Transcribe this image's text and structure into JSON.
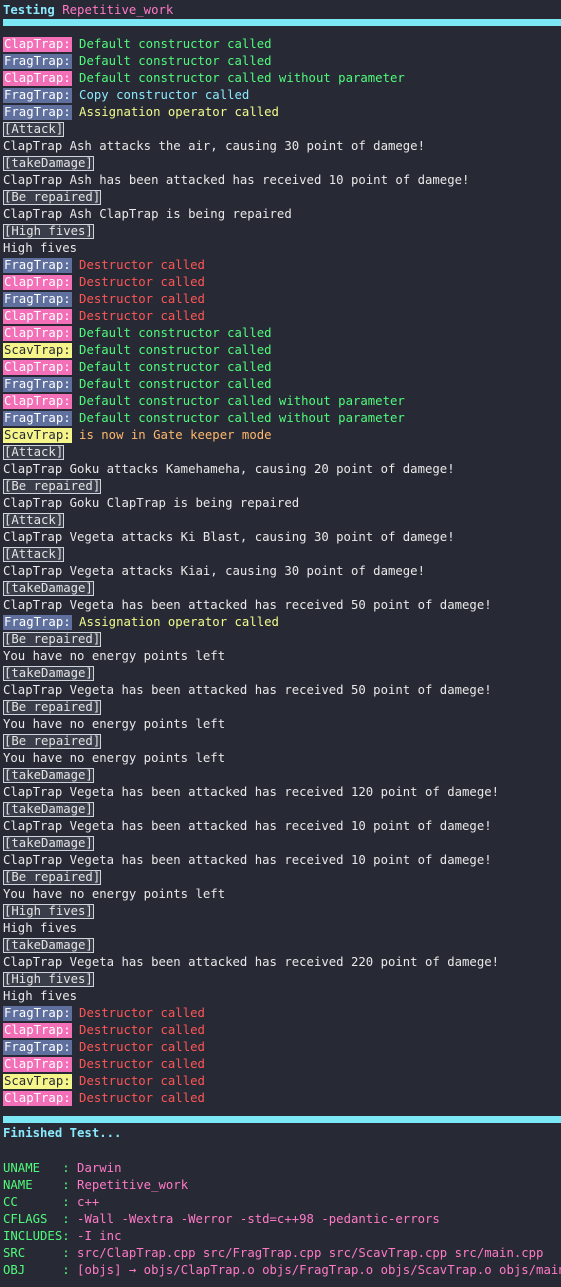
{
  "header": {
    "label": "Testing",
    "name": "Repetitive_work"
  },
  "lines": [
    {
      "kind": "tagged",
      "tag": "ClapTrap:",
      "cls": "clap",
      "text": "Default constructor called",
      "color": "green"
    },
    {
      "kind": "tagged",
      "tag": "FragTrap:",
      "cls": "frag",
      "text": "Default constructor called",
      "color": "green"
    },
    {
      "kind": "tagged",
      "tag": "ClapTrap:",
      "cls": "clap",
      "text": "Default constructor called without parameter",
      "color": "green"
    },
    {
      "kind": "tagged",
      "tag": "FragTrap:",
      "cls": "frag",
      "text": "Copy constructor called",
      "color": "cyan"
    },
    {
      "kind": "tagged",
      "tag": "FragTrap:",
      "cls": "frag",
      "text": "Assignation operator called",
      "color": "yellow"
    },
    {
      "kind": "action",
      "text": "[Attack]"
    },
    {
      "kind": "plain",
      "text": "ClapTrap Ash attacks the air, causing 30 point of damege!"
    },
    {
      "kind": "action",
      "text": "[takeDamage]"
    },
    {
      "kind": "plain",
      "text": "ClapTrap Ash has been attacked has received 10 point of damege!"
    },
    {
      "kind": "action",
      "text": "[Be repaired]"
    },
    {
      "kind": "plain",
      "text": "ClapTrap Ash ClapTrap is being repaired"
    },
    {
      "kind": "action",
      "text": "[High fives]"
    },
    {
      "kind": "plain",
      "text": "High fives"
    },
    {
      "kind": "tagged",
      "tag": "FragTrap:",
      "cls": "frag",
      "text": "Destructor called",
      "color": "red"
    },
    {
      "kind": "tagged",
      "tag": "ClapTrap:",
      "cls": "clap",
      "text": "Destructor called",
      "color": "red"
    },
    {
      "kind": "tagged",
      "tag": "FragTrap:",
      "cls": "frag",
      "text": "Destructor called",
      "color": "red"
    },
    {
      "kind": "tagged",
      "tag": "ClapTrap:",
      "cls": "clap",
      "text": "Destructor called",
      "color": "red"
    },
    {
      "kind": "tagged",
      "tag": "ClapTrap:",
      "cls": "clap",
      "text": "Default constructor called",
      "color": "green"
    },
    {
      "kind": "tagged",
      "tag": "ScavTrap:",
      "cls": "scav",
      "text": "Default constructor called",
      "color": "green"
    },
    {
      "kind": "tagged",
      "tag": "ClapTrap:",
      "cls": "clap",
      "text": "Default constructor called",
      "color": "green"
    },
    {
      "kind": "tagged",
      "tag": "FragTrap:",
      "cls": "frag",
      "text": "Default constructor called",
      "color": "green"
    },
    {
      "kind": "tagged",
      "tag": "ClapTrap:",
      "cls": "clap",
      "text": "Default constructor called without parameter",
      "color": "green"
    },
    {
      "kind": "tagged",
      "tag": "FragTrap:",
      "cls": "frag",
      "text": "Default constructor called without parameter",
      "color": "green"
    },
    {
      "kind": "tagged",
      "tag": "ScavTrap:",
      "cls": "scav",
      "text": "is now in Gate keeper mode",
      "color": "orange"
    },
    {
      "kind": "action",
      "text": "[Attack]"
    },
    {
      "kind": "plain",
      "text": "ClapTrap Goku attacks Kamehameha, causing 20 point of damege!"
    },
    {
      "kind": "action",
      "text": "[Be repaired]"
    },
    {
      "kind": "plain",
      "text": "ClapTrap Goku ClapTrap is being repaired"
    },
    {
      "kind": "action",
      "text": "[Attack]"
    },
    {
      "kind": "plain",
      "text": "ClapTrap Vegeta attacks Ki Blast, causing 30 point of damege!"
    },
    {
      "kind": "action",
      "text": "[Attack]"
    },
    {
      "kind": "plain",
      "text": "ClapTrap Vegeta attacks Kiai, causing 30 point of damege!"
    },
    {
      "kind": "action",
      "text": "[takeDamage]"
    },
    {
      "kind": "plain",
      "text": "ClapTrap Vegeta has been attacked has received 50 point of damege!"
    },
    {
      "kind": "tagged",
      "tag": "FragTrap:",
      "cls": "frag",
      "text": "Assignation operator called",
      "color": "yellow"
    },
    {
      "kind": "action",
      "text": "[Be repaired]"
    },
    {
      "kind": "plain",
      "text": "You have no energy points left"
    },
    {
      "kind": "action",
      "text": "[takeDamage]"
    },
    {
      "kind": "plain",
      "text": "ClapTrap Vegeta has been attacked has received 50 point of damege!"
    },
    {
      "kind": "action",
      "text": "[Be repaired]"
    },
    {
      "kind": "plain",
      "text": "You have no energy points left"
    },
    {
      "kind": "action",
      "text": "[Be repaired]"
    },
    {
      "kind": "plain",
      "text": "You have no energy points left"
    },
    {
      "kind": "action",
      "text": "[takeDamage]"
    },
    {
      "kind": "plain",
      "text": "ClapTrap Vegeta has been attacked has received 120 point of damege!"
    },
    {
      "kind": "action",
      "text": "[takeDamage]"
    },
    {
      "kind": "plain",
      "text": "ClapTrap Vegeta has been attacked has received 10 point of damege!"
    },
    {
      "kind": "action",
      "text": "[takeDamage]"
    },
    {
      "kind": "plain",
      "text": "ClapTrap Vegeta has been attacked has received 10 point of damege!"
    },
    {
      "kind": "action",
      "text": "[Be repaired]"
    },
    {
      "kind": "plain",
      "text": "You have no energy points left"
    },
    {
      "kind": "action",
      "text": "[High fives]"
    },
    {
      "kind": "plain",
      "text": "High fives"
    },
    {
      "kind": "action",
      "text": "[takeDamage]"
    },
    {
      "kind": "plain",
      "text": "ClapTrap Vegeta has been attacked has received 220 point of damege!"
    },
    {
      "kind": "action",
      "text": "[High fives]"
    },
    {
      "kind": "plain",
      "text": "High fives"
    },
    {
      "kind": "tagged",
      "tag": "FragTrap:",
      "cls": "frag",
      "text": "Destructor called",
      "color": "red"
    },
    {
      "kind": "tagged",
      "tag": "ClapTrap:",
      "cls": "clap",
      "text": "Destructor called",
      "color": "red"
    },
    {
      "kind": "tagged",
      "tag": "FragTrap:",
      "cls": "frag",
      "text": "Destructor called",
      "color": "red"
    },
    {
      "kind": "tagged",
      "tag": "ClapTrap:",
      "cls": "clap",
      "text": "Destructor called",
      "color": "red"
    },
    {
      "kind": "tagged",
      "tag": "ScavTrap:",
      "cls": "scav",
      "text": "Destructor called",
      "color": "red"
    },
    {
      "kind": "tagged",
      "tag": "ClapTrap:",
      "cls": "clap",
      "text": "Destructor called",
      "color": "red"
    }
  ],
  "footer": {
    "finished": "Finished Test...",
    "info": [
      {
        "key": "UNAME   : ",
        "value": "Darwin"
      },
      {
        "key": "NAME    : ",
        "value": "Repetitive_work"
      },
      {
        "key": "CC      : ",
        "value": "c++"
      },
      {
        "key": "CFLAGS  : ",
        "value": "-Wall -Wextra -Werror -std=c++98 -pedantic-errors"
      },
      {
        "key": "INCLUDES: ",
        "value": "-I inc"
      },
      {
        "key": "SRC     : ",
        "value": "src/ClapTrap.cpp src/FragTrap.cpp src/ScavTrap.cpp src/main.cpp"
      },
      {
        "key": "OBJ     : ",
        "value": "[objs] → objs/ClapTrap.o objs/FragTrap.o objs/ScavTrap.o objs/main.o"
      }
    ]
  },
  "colors": {
    "background": "#272a35",
    "accent_bar": "#7ce8f5",
    "tag_claptrap": "#f36fb7",
    "tag_fragtrap": "#5f6f9e",
    "tag_scavtrap": "#f5f58a",
    "green": "#50fa7b",
    "cyan": "#8be9fd",
    "yellow": "#f1fa8c",
    "red": "#ff5555",
    "orange": "#ffb86c",
    "pink": "#ff79c6"
  }
}
